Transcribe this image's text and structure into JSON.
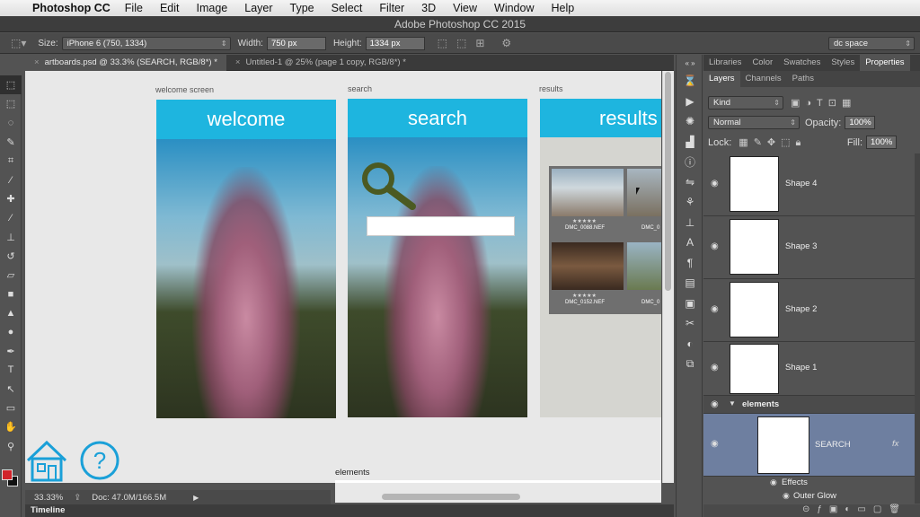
{
  "menubar": {
    "app": "Photoshop CC",
    "items": [
      "File",
      "Edit",
      "Image",
      "Layer",
      "Type",
      "Select",
      "Filter",
      "3D",
      "View",
      "Window",
      "Help"
    ]
  },
  "window": {
    "title": "Adobe Photoshop CC 2015"
  },
  "options": {
    "size_label": "Size:",
    "size_value": "iPhone 6 (750, 1334)",
    "width_label": "Width:",
    "width_value": "750 px",
    "height_label": "Height:",
    "height_value": "1334 px",
    "workspace": "dc space"
  },
  "tabs": [
    {
      "label": "artboards.psd @ 33.3% (SEARCH, RGB/8*) *"
    },
    {
      "label": "Untitled-1 @ 25% (page 1 copy, RGB/8*) *"
    }
  ],
  "artboards": [
    {
      "label": "welcome screen",
      "header": "welcome"
    },
    {
      "label": "search",
      "header": "search"
    },
    {
      "label": "results",
      "header": "results"
    }
  ],
  "results": {
    "files": [
      "DMC_0088.NEF",
      "DMC_0",
      "DMC_0152.NEF",
      "DMC_0"
    ],
    "stars": "★★★★★"
  },
  "canvas": {
    "elements_label": "elements"
  },
  "status": {
    "zoom": "33.33%",
    "doc": "Doc: 47.0M/166.5M"
  },
  "timeline": {
    "label": "Timeline"
  },
  "panels": {
    "top_tabs": [
      "Libraries",
      "Color",
      "Swatches",
      "Styles",
      "Properties"
    ],
    "layer_tabs": [
      "Layers",
      "Channels",
      "Paths"
    ],
    "kind": "Kind",
    "blend_mode": "Normal",
    "opacity_label": "Opacity:",
    "opacity_value": "100%",
    "lock_label": "Lock:",
    "fill_label": "Fill:",
    "fill_value": "100%",
    "layers": [
      "Shape 4",
      "Shape 3",
      "Shape 2",
      "Shape 1"
    ],
    "group": "elements",
    "search_layer": "SEARCH",
    "fx": "fx",
    "effects": "Effects",
    "outer_glow": "Outer Glow"
  },
  "colors": {
    "header_blue": "#1eb5df",
    "search_icon": "#4b5a22",
    "foreground": "#d2232a",
    "background": "#111111",
    "icon_blue": "#1aa0d8"
  }
}
